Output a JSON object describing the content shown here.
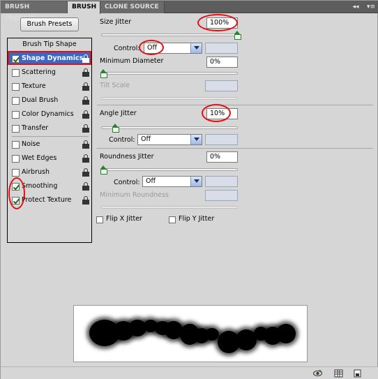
{
  "tabs": [
    {
      "label": "BRUSH PRESETS",
      "active": false
    },
    {
      "label": "BRUSH",
      "active": true
    },
    {
      "label": "CLONE SOURCE",
      "active": false
    }
  ],
  "tabbar_buttons": {
    "collapse": "◂◂",
    "menu": "▾≡"
  },
  "left": {
    "brush_presets_button": "Brush Presets",
    "header": "Brush Tip Shape",
    "items": [
      {
        "label": "Shape Dynamics",
        "checked": true,
        "selected": true
      },
      {
        "label": "Scattering",
        "checked": false
      },
      {
        "label": "Texture",
        "checked": false
      },
      {
        "label": "Dual Brush",
        "checked": false
      },
      {
        "label": "Color Dynamics",
        "checked": false
      },
      {
        "label": "Transfer",
        "checked": false
      },
      {
        "label": "Noise",
        "checked": false
      },
      {
        "label": "Wet Edges",
        "checked": false
      },
      {
        "label": "Airbrush",
        "checked": false
      },
      {
        "label": "Smoothing",
        "checked": true
      },
      {
        "label": "Protect Texture",
        "checked": true
      }
    ]
  },
  "settings": {
    "size_jitter": {
      "label": "Size Jitter",
      "value": "100%",
      "level": 1.0
    },
    "size_control": {
      "label": "Control:",
      "value": "Off"
    },
    "minimum_diameter": {
      "label": "Minimum Diameter",
      "value": "0%",
      "level": 0.0
    },
    "tilt_scale": {
      "label": "Tilt Scale",
      "value": ""
    },
    "angle_jitter": {
      "label": "Angle Jitter",
      "value": "10%",
      "level": 0.1
    },
    "angle_control": {
      "label": "Control:",
      "value": "Off"
    },
    "roundness_jitter": {
      "label": "Roundness Jitter",
      "value": "0%",
      "level": 0.0
    },
    "roundness_control": {
      "label": "Control:",
      "value": "Off"
    },
    "minimum_roundness": {
      "label": "Minimum Roundness",
      "value": ""
    },
    "flip_x": {
      "label": "Flip X Jitter",
      "checked": false
    },
    "flip_y": {
      "label": "Flip Y Jitter",
      "checked": false
    }
  },
  "colors": {
    "annotation": "#e01010",
    "selection": "#3b67c4",
    "slider_thumb": "#2e7d32"
  },
  "icons": [
    "lock-icon",
    "eye-icon",
    "grid-icon",
    "new-preset-icon"
  ]
}
